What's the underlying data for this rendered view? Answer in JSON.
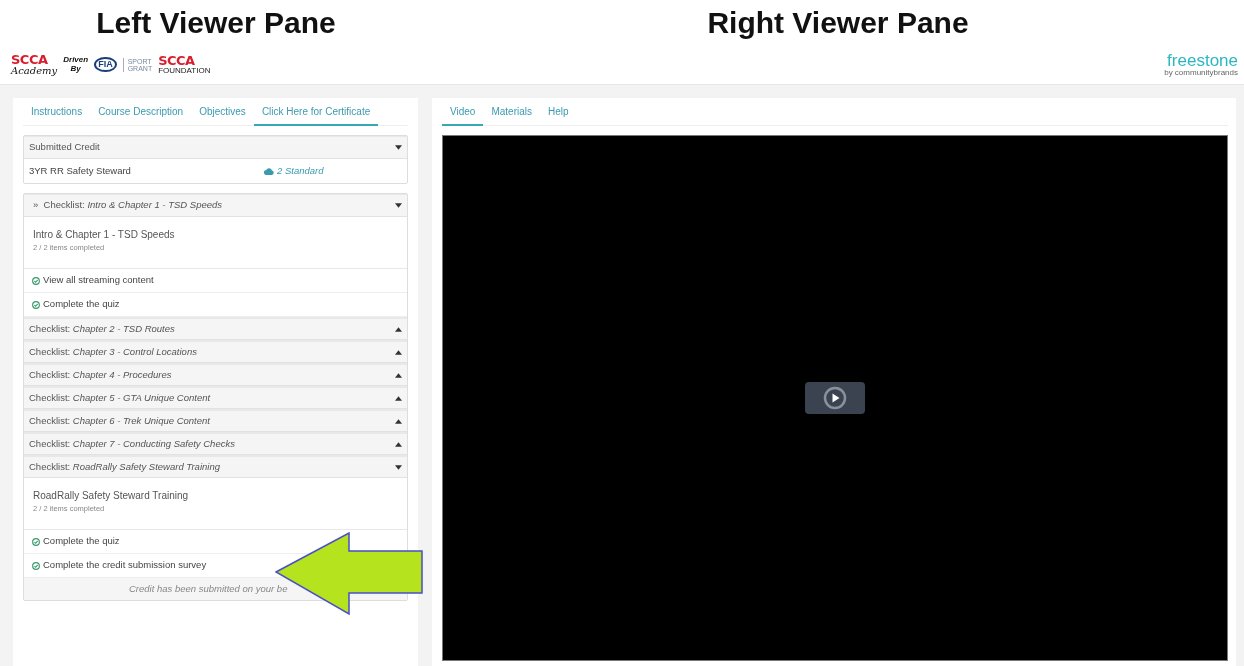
{
  "pane_titles": [
    "Left Viewer Pane",
    "Right Viewer Pane"
  ],
  "header": {
    "brand_texts": [
      "SCCA",
      "Academy",
      "Driven",
      "By",
      "FIA",
      "SPORT",
      "GRANT",
      "SCCA",
      "FOUNDATION"
    ],
    "right_logo": {
      "name": "freestone",
      "tagline": "by communitybrands"
    }
  },
  "left_pane": {
    "tabs": [
      {
        "label": "Instructions",
        "selected": false
      },
      {
        "label": "Course Description",
        "selected": false
      },
      {
        "label": "Objectives",
        "selected": false
      },
      {
        "label": "Click Here for Certificate",
        "selected": true
      }
    ],
    "submitted_credit": {
      "title": "Submitted Credit",
      "expanded": true,
      "row": {
        "name": "3YR RR Safety Steward",
        "standard": "2 Standard"
      }
    },
    "checklists": [
      {
        "marker": "»",
        "prefix": "Checklist:",
        "title": "Intro & Chapter 1 - TSD Speeds",
        "expanded": true,
        "heading": "Intro & Chapter 1 - TSD Speeds",
        "progress": "2 / 2 items completed",
        "items": [
          {
            "text": "View all streaming content",
            "checked": true
          },
          {
            "text": "Complete the quiz",
            "checked": true
          }
        ]
      },
      {
        "prefix": "Checklist:",
        "title": "Chapter 2 - TSD Routes",
        "expanded": false
      },
      {
        "prefix": "Checklist:",
        "title": "Chapter 3 - Control Locations",
        "expanded": false
      },
      {
        "prefix": "Checklist:",
        "title": "Chapter 4 - Procedures",
        "expanded": false
      },
      {
        "prefix": "Checklist:",
        "title": "Chapter 5 - GTA Unique Content",
        "expanded": false
      },
      {
        "prefix": "Checklist:",
        "title": "Chapter 6 - Trek Unique Content",
        "expanded": false
      },
      {
        "prefix": "Checklist:",
        "title": "Chapter 7 - Conducting Safety Checks",
        "expanded": false
      },
      {
        "prefix": "Checklist:",
        "title": "RoadRally Safety Steward Training",
        "expanded": true,
        "heading": "RoadRally Safety Steward Training",
        "progress": "2 / 2 items completed",
        "items": [
          {
            "text": "Complete the quiz",
            "checked": true
          },
          {
            "text": "Complete the credit submission survey",
            "checked": true
          }
        ]
      }
    ],
    "footer_note": "Credit has been submitted on your be"
  },
  "annotation": {
    "kind": "arrow"
  },
  "right_pane": {
    "tabs": [
      {
        "label": "Video",
        "selected": true
      },
      {
        "label": "Materials",
        "selected": false
      },
      {
        "label": "Help",
        "selected": false
      }
    ],
    "video": {
      "playing": false
    }
  }
}
